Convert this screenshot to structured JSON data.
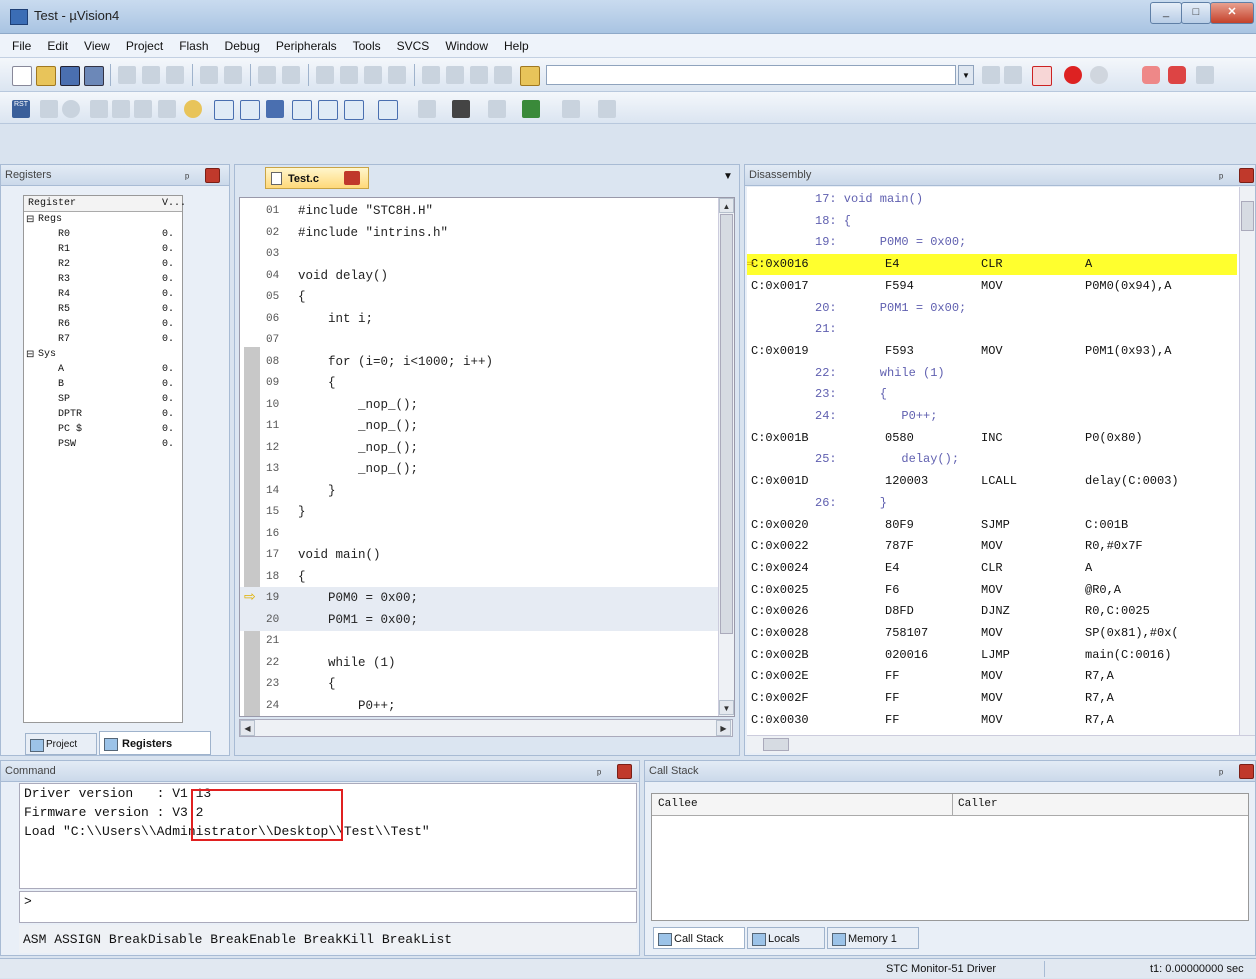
{
  "window": {
    "title": "Test - µVision4"
  },
  "menu": [
    "File",
    "Edit",
    "View",
    "Project",
    "Flash",
    "Debug",
    "Peripherals",
    "Tools",
    "SVCS",
    "Window",
    "Help"
  ],
  "registers_panel": {
    "title": "Registers",
    "col_register": "Register",
    "col_value": "V...",
    "groups": [
      {
        "name": "Regs",
        "items": [
          {
            "name": "R0",
            "value": "0."
          },
          {
            "name": "R1",
            "value": "0."
          },
          {
            "name": "R2",
            "value": "0."
          },
          {
            "name": "R3",
            "value": "0."
          },
          {
            "name": "R4",
            "value": "0."
          },
          {
            "name": "R5",
            "value": "0."
          },
          {
            "name": "R6",
            "value": "0."
          },
          {
            "name": "R7",
            "value": "0."
          }
        ]
      },
      {
        "name": "Sys",
        "items": [
          {
            "name": "A",
            "value": "0."
          },
          {
            "name": "B",
            "value": "0."
          },
          {
            "name": "SP",
            "value": "0."
          },
          {
            "name": "DPTR",
            "value": "0."
          },
          {
            "name": "PC $",
            "value": "0."
          },
          {
            "name": "PSW",
            "value": "0."
          }
        ]
      }
    ],
    "tab_project": "Project",
    "tab_registers": "Registers"
  },
  "editor": {
    "tab_label": "Test.c",
    "lines": [
      {
        "no": "01",
        "code": "#include \"STC8H.H\""
      },
      {
        "no": "02",
        "code": "#include \"intrins.h\""
      },
      {
        "no": "03",
        "code": ""
      },
      {
        "no": "04",
        "code": "void delay()"
      },
      {
        "no": "05",
        "code": "{"
      },
      {
        "no": "06",
        "code": "    int i;"
      },
      {
        "no": "07",
        "code": ""
      },
      {
        "no": "08",
        "code": "    for (i=0; i<1000; i++)"
      },
      {
        "no": "09",
        "code": "    {"
      },
      {
        "no": "10",
        "code": "        _nop_();"
      },
      {
        "no": "11",
        "code": "        _nop_();"
      },
      {
        "no": "12",
        "code": "        _nop_();"
      },
      {
        "no": "13",
        "code": "        _nop_();"
      },
      {
        "no": "14",
        "code": "    }"
      },
      {
        "no": "15",
        "code": "}"
      },
      {
        "no": "16",
        "code": ""
      },
      {
        "no": "17",
        "code": "void main()"
      },
      {
        "no": "18",
        "code": "{"
      },
      {
        "no": "19",
        "code": "    P0M0 = 0x00;"
      },
      {
        "no": "20",
        "code": "    P0M1 = 0x00;"
      },
      {
        "no": "21",
        "code": ""
      },
      {
        "no": "22",
        "code": "    while (1)"
      },
      {
        "no": "23",
        "code": "    {"
      },
      {
        "no": "24",
        "code": "        P0++;"
      }
    ]
  },
  "disassembly": {
    "title": "Disassembly",
    "rows": [
      {
        "kind": "src",
        "text": "17: void main()"
      },
      {
        "kind": "src",
        "text": "18: {"
      },
      {
        "kind": "src",
        "text": "19:      P0M0 = 0x00;"
      },
      {
        "kind": "asm",
        "addr": "C:0x0016",
        "hex": "E4",
        "op": "CLR",
        "arg": "A",
        "current": true
      },
      {
        "kind": "asm",
        "addr": "C:0x0017",
        "hex": "F594",
        "op": "MOV",
        "arg": "P0M0(0x94),A"
      },
      {
        "kind": "src",
        "text": "20:      P0M1 = 0x00;"
      },
      {
        "kind": "src",
        "text": "21:"
      },
      {
        "kind": "asm",
        "addr": "C:0x0019",
        "hex": "F593",
        "op": "MOV",
        "arg": "P0M1(0x93),A"
      },
      {
        "kind": "src",
        "text": "22:      while (1)"
      },
      {
        "kind": "src",
        "text": "23:      {"
      },
      {
        "kind": "src",
        "text": "24:         P0++;"
      },
      {
        "kind": "asm",
        "addr": "C:0x001B",
        "hex": "0580",
        "op": "INC",
        "arg": "P0(0x80)"
      },
      {
        "kind": "src",
        "text": "25:         delay();"
      },
      {
        "kind": "asm",
        "addr": "C:0x001D",
        "hex": "120003",
        "op": "LCALL",
        "arg": "delay(C:0003)"
      },
      {
        "kind": "src",
        "text": "26:      }"
      },
      {
        "kind": "asm",
        "addr": "C:0x0020",
        "hex": "80F9",
        "op": "SJMP",
        "arg": "C:001B"
      },
      {
        "kind": "asm",
        "addr": "C:0x0022",
        "hex": "787F",
        "op": "MOV",
        "arg": "R0,#0x7F"
      },
      {
        "kind": "asm",
        "addr": "C:0x0024",
        "hex": "E4",
        "op": "CLR",
        "arg": "A"
      },
      {
        "kind": "asm",
        "addr": "C:0x0025",
        "hex": "F6",
        "op": "MOV",
        "arg": "@R0,A"
      },
      {
        "kind": "asm",
        "addr": "C:0x0026",
        "hex": "D8FD",
        "op": "DJNZ",
        "arg": "R0,C:0025"
      },
      {
        "kind": "asm",
        "addr": "C:0x0028",
        "hex": "758107",
        "op": "MOV",
        "arg": "SP(0x81),#0x("
      },
      {
        "kind": "asm",
        "addr": "C:0x002B",
        "hex": "020016",
        "op": "LJMP",
        "arg": "main(C:0016)"
      },
      {
        "kind": "asm",
        "addr": "C:0x002E",
        "hex": "FF",
        "op": "MOV",
        "arg": "R7,A"
      },
      {
        "kind": "asm",
        "addr": "C:0x002F",
        "hex": "FF",
        "op": "MOV",
        "arg": "R7,A"
      },
      {
        "kind": "asm",
        "addr": "C:0x0030",
        "hex": "FF",
        "op": "MOV",
        "arg": "R7,A"
      }
    ]
  },
  "command": {
    "title": "Command",
    "lines": [
      "Driver version   : V1.13",
      "Firmware version : V3.2",
      "Load \"C:\\\\Users\\\\Administrator\\\\Desktop\\\\Test\\\\Test\""
    ],
    "prompt": ">",
    "hint": "ASM ASSIGN BreakDisable BreakEnable BreakKill BreakList"
  },
  "callstack": {
    "title": "Call Stack",
    "col_callee": "Callee",
    "col_caller": "Caller",
    "tabs": [
      "Call Stack",
      "Locals",
      "Memory 1"
    ]
  },
  "status": {
    "driver": "STC Monitor-51 Driver",
    "time": "t1: 0.00000000 sec"
  },
  "colors": {
    "highlight": "#ffff2e",
    "accent": "#e02020",
    "bg": "#d9e3ef"
  }
}
